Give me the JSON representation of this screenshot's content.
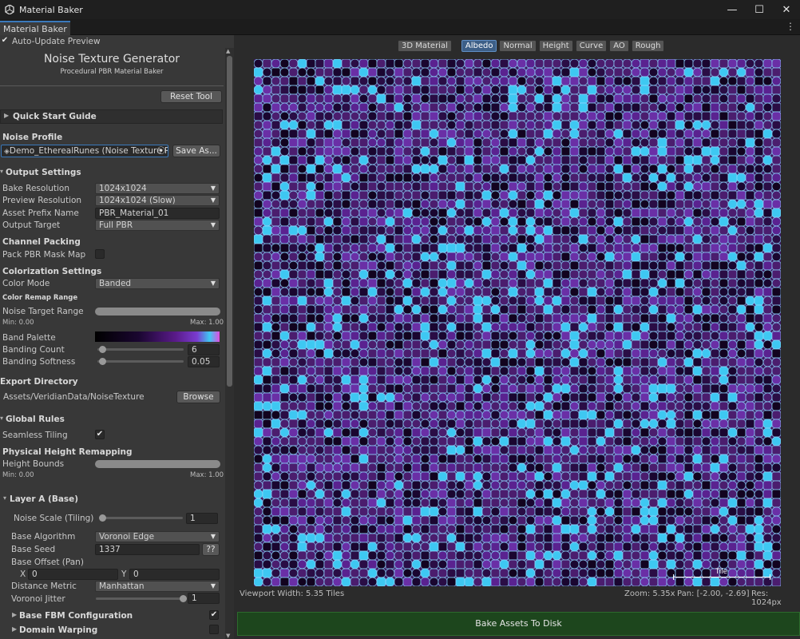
{
  "window": {
    "title": "Material Baker",
    "tab": "Material Baker",
    "minimize": "—",
    "maximize": "☐",
    "close": "✕",
    "menu": "⋮"
  },
  "header": {
    "auto_update_label": "Auto-Update Preview",
    "title": "Noise Texture Generator",
    "subtitle": "Procedural PBR Material Baker",
    "reset_label": "Reset Tool"
  },
  "quick_start": {
    "label": "Quick Start Guide"
  },
  "noise_profile": {
    "heading": "Noise Profile",
    "value": "Demo_EtherealRunes (Noise Texture Profi",
    "save_label": "Save As..."
  },
  "output": {
    "heading": "Output Settings",
    "bake_resolution_label": "Bake Resolution",
    "bake_resolution_value": "1024x1024",
    "preview_resolution_label": "Preview Resolution",
    "preview_resolution_value": "1024x1024 (Slow)",
    "prefix_label": "Asset Prefix Name",
    "prefix_value": "PBR_Material_01",
    "target_label": "Output Target",
    "target_value": "Full PBR"
  },
  "channel_packing": {
    "heading": "Channel Packing",
    "pack_label": "Pack PBR Mask Map"
  },
  "colorization": {
    "heading": "Colorization Settings",
    "color_mode_label": "Color Mode",
    "color_mode_value": "Banded",
    "remap_heading": "Color Remap Range",
    "target_range_label": "Noise Target Range",
    "min_label": "Min: 0.00",
    "max_label": "Max: 1.00",
    "palette_label": "Band Palette",
    "banding_count_label": "Banding Count",
    "banding_count_value": "6",
    "banding_softness_label": "Banding Softness",
    "banding_softness_value": "0.05"
  },
  "export": {
    "heading": "Export Directory",
    "path": "Assets/VeridianData/NoiseTexture",
    "browse_label": "Browse"
  },
  "global_rules": {
    "heading": "Global Rules",
    "seamless_label": "Seamless Tiling",
    "height_heading": "Physical Height Remapping",
    "height_bounds_label": "Height Bounds",
    "min_label": "Min: 0.00",
    "max_label": "Max: 1.00"
  },
  "layer_a": {
    "heading": "Layer A (Base)",
    "noise_scale_label": "Noise Scale (Tiling)",
    "noise_scale_value": "1",
    "algorithm_label": "Base Algorithm",
    "algorithm_value": "Voronoi Edge",
    "seed_label": "Base Seed",
    "seed_value": "1337",
    "seed_btn": "??",
    "offset_label": "Base Offset (Pan)",
    "x_label": "X",
    "x_value": "0",
    "y_label": "Y",
    "y_value": "0",
    "metric_label": "Distance Metric",
    "metric_value": "Manhattan",
    "jitter_label": "Voronoi Jitter",
    "jitter_value": "1",
    "fbm_label": "Base FBM Configuration",
    "warp_label": "Domain Warping"
  },
  "viewport": {
    "buttons": [
      "3D Material",
      "Albedo",
      "Normal",
      "Height",
      "Curve",
      "AO",
      "Rough"
    ],
    "active": "Albedo",
    "tile_label": "Tile",
    "width_text": "Viewport Width: 5.35 Tiles",
    "zoom_text": "Zoom: 5.35x",
    "pan_text": "Pan: [-2.00, -2.69]",
    "res_text": "Res: 1024px",
    "bake_label": "Bake Assets To Disk"
  },
  "colors": {
    "accent": "#3a79bb",
    "bake_green": "#1d461d",
    "purple": "#4b1d6e",
    "cyan": "#5fd0f0"
  },
  "icons": {
    "app": "unity-logo-icon",
    "object_picker": "target-icon",
    "foldout_closed": "triangle-right-icon",
    "foldout_open": "triangle-down-icon"
  }
}
